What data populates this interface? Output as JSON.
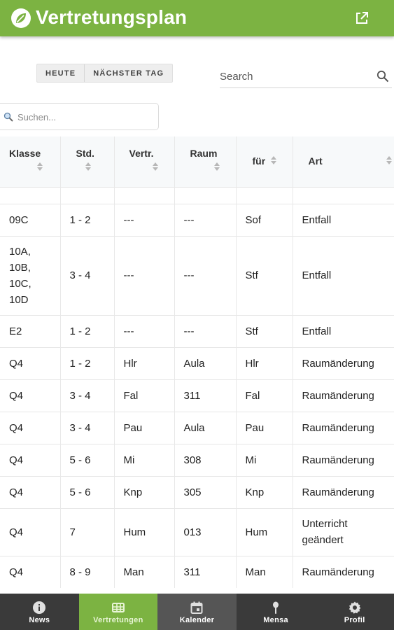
{
  "appbar": {
    "title": "Vertretungsplan",
    "logo_icon": "leaf-logo-icon",
    "action_icon": "open-in-new-icon",
    "color": "#7cb342"
  },
  "day_buttons": {
    "today": "HEUTE",
    "next_day": "NÄCHSTER TAG"
  },
  "search": {
    "label": "Search",
    "icon": "search-icon"
  },
  "filter": {
    "placeholder": "Suchen...",
    "icon": "magnifier-icon"
  },
  "table": {
    "columns": [
      "Klasse",
      "Std.",
      "Vertr.",
      "Raum",
      "für",
      "Art"
    ],
    "rows": [
      {
        "klasse": "09C",
        "std": "1 - 2",
        "vertr": "---",
        "raum": "---",
        "fuer": "Sof",
        "art": "Entfall"
      },
      {
        "klasse": "10A,\n10B,\n10C,\n10D",
        "std": "3 - 4",
        "vertr": "---",
        "raum": "---",
        "fuer": "Stf",
        "art": "Entfall"
      },
      {
        "klasse": "E2",
        "std": "1 - 2",
        "vertr": "---",
        "raum": "---",
        "fuer": "Stf",
        "art": "Entfall"
      },
      {
        "klasse": "Q4",
        "std": "1 - 2",
        "vertr": "Hlr",
        "raum": "Aula",
        "fuer": "Hlr",
        "art": "Raumänderung"
      },
      {
        "klasse": "Q4",
        "std": "3 - 4",
        "vertr": "Fal",
        "raum": "311",
        "fuer": "Fal",
        "art": "Raumänderung"
      },
      {
        "klasse": "Q4",
        "std": "3 - 4",
        "vertr": "Pau",
        "raum": "Aula",
        "fuer": "Pau",
        "art": "Raumänderung"
      },
      {
        "klasse": "Q4",
        "std": "5 - 6",
        "vertr": "Mi",
        "raum": "308",
        "fuer": "Mi",
        "art": "Raumänderung"
      },
      {
        "klasse": "Q4",
        "std": "5 - 6",
        "vertr": "Knp",
        "raum": "305",
        "fuer": "Knp",
        "art": "Raumänderung"
      },
      {
        "klasse": "Q4",
        "std": "7",
        "vertr": "Hum",
        "raum": "013",
        "fuer": "Hum",
        "art": "Unterricht\ngeändert"
      },
      {
        "klasse": "Q4",
        "std": "8 - 9",
        "vertr": "Man",
        "raum": "311",
        "fuer": "Man",
        "art": "Raumänderung"
      }
    ]
  },
  "bottom_nav": {
    "items": [
      {
        "label": "News",
        "icon": "info-icon"
      },
      {
        "label": "Vertretungen",
        "icon": "table-icon"
      },
      {
        "label": "Kalender",
        "icon": "calendar-icon"
      },
      {
        "label": "Mensa",
        "icon": "mensa-icon"
      },
      {
        "label": "Profil",
        "icon": "gear-icon"
      }
    ],
    "active_index": 1
  }
}
